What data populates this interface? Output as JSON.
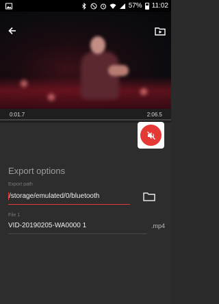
{
  "status_bar": {
    "time": "11:02",
    "battery": "57%",
    "icons": [
      "image-icon",
      "bluetooth-icon",
      "mute-icon",
      "alarm-icon",
      "wifi-icon",
      "signal-icon",
      "battery-icon"
    ]
  },
  "player": {
    "current_time": "0:01.7",
    "end_time": "2:06.5"
  },
  "export": {
    "title": "Export options",
    "path_label": "Export path",
    "path_value": "/storage/emulated/0/bluetooth",
    "file_label": "File 1",
    "file_value": "VID-20190205-WA0000 1",
    "file_extension": ".mp4"
  },
  "colors": {
    "accent": "#e53935",
    "background": "#2d2d2d",
    "status_bar": "#000000"
  }
}
